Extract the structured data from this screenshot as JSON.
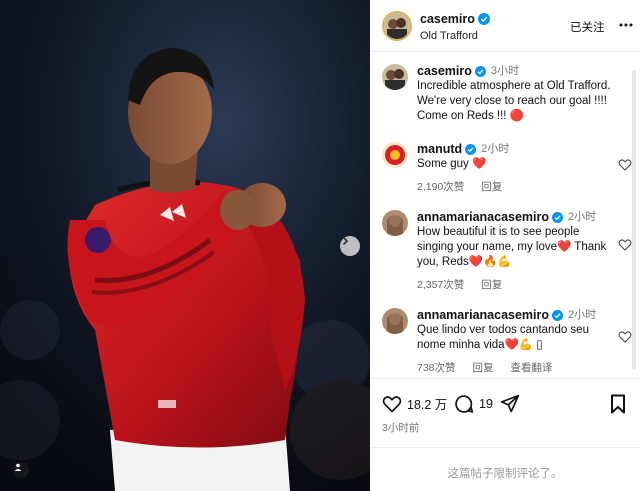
{
  "post": {
    "username": "casemiro",
    "location": "Old Trafford",
    "follow_label": "已关注"
  },
  "caption": {
    "username": "casemiro",
    "time": "3小时",
    "text": "Incredible atmosphere at Old Trafford. We're very close to reach our goal !!!! Come on Reds !!! 🔴"
  },
  "comments": [
    {
      "username": "manutd",
      "time": "2小时",
      "text": "Some guy ❤️",
      "likes": "2,190次赞",
      "reply": "回复"
    },
    {
      "username": "annamarianacasemiro",
      "time": "2小时",
      "text": "How beautiful it is to see people singing your name, my love❤️ Thank you, Reds❤️🔥💪",
      "likes": "2,357次赞",
      "reply": "回复"
    },
    {
      "username": "annamarianacasemiro",
      "time": "2小时",
      "text": "Que lindo ver todos cantando seu nome minha vida❤️💪 ▯",
      "likes": "738次赞",
      "reply": "回复",
      "translate": "查看翻译"
    }
  ],
  "actions": {
    "like_count": "18.2 万",
    "comment_count": "19"
  },
  "posted_ago": "3小时前",
  "comments_limited": "这篇帖子限制评论了。",
  "icons": [
    "heart-icon",
    "comment-icon",
    "share-icon",
    "bookmark-icon",
    "more-icon",
    "verified-icon",
    "chevron-right-icon",
    "user-tag-icon"
  ],
  "colors": {
    "verified": "#0095f6",
    "like_red": "#e0245e",
    "jersey_red": "#c8141b"
  }
}
